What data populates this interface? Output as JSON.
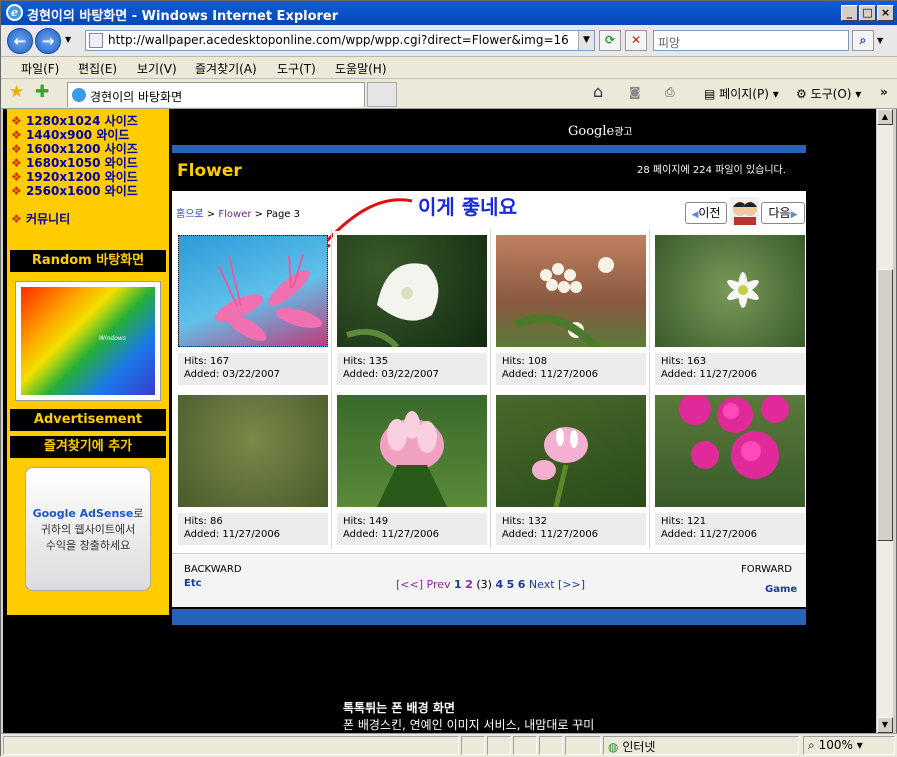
{
  "window": {
    "title": "경현이의 바탕화면 - Windows Internet Explorer"
  },
  "address": {
    "url": "http://wallpaper.acedesktoponline.com/wpp/wpp.cgi?direct=Flower&img=16",
    "search_placeholder": "피앙"
  },
  "menu": [
    "파일(F)",
    "편집(E)",
    "보기(V)",
    "즐겨찾기(A)",
    "도구(T)",
    "도움말(H)"
  ],
  "tab": {
    "label": "경현이의 바탕화면"
  },
  "toolbar": {
    "page_label": "페이지(P)",
    "tools_label": "도구(O)"
  },
  "sidebar": {
    "links": [
      "1280x1024 사이즈",
      "1440x900 와이드",
      "1600x1200 사이즈",
      "1680x1050 와이드",
      "1920x1200 와이드",
      "2560x1600 와이드"
    ],
    "community": "커뮤니티",
    "random_header": "Random 바탕화면",
    "random_img_text": "Windows",
    "ad_header": "Advertisement",
    "fav_header": "즐겨찾기에 추가",
    "adsense_brand": "Google AdSense",
    "adsense_line1": "로",
    "adsense_line2": "귀하의 웹사이트에서",
    "adsense_line3": "수익을 창출하세요"
  },
  "google_ad": {
    "brand": "Google",
    "suffix": "광고"
  },
  "gallery": {
    "title": "Flower",
    "page_count": "28 페이지에 224 파일이 있습니다.",
    "crumb_home": "홈으로",
    "crumb_sep1": ">",
    "crumb_cat": "Flower",
    "crumb_sep2": ">",
    "crumb_page": "Page 3",
    "annotation": "이게 좋네요",
    "prev": "이전",
    "next": "다음",
    "items": [
      {
        "hits": "Hits: 167",
        "added": "Added: 03/22/2007"
      },
      {
        "hits": "Hits: 135",
        "added": "Added: 03/22/2007"
      },
      {
        "hits": "Hits: 108",
        "added": "Added: 11/27/2006"
      },
      {
        "hits": "Hits: 163",
        "added": "Added: 11/27/2006"
      },
      {
        "hits": "Hits: 86",
        "added": "Added: 11/27/2006"
      },
      {
        "hits": "Hits: 149",
        "added": "Added: 11/27/2006"
      },
      {
        "hits": "Hits: 132",
        "added": "Added: 11/27/2006"
      },
      {
        "hits": "Hits: 121",
        "added": "Added: 11/27/2006"
      }
    ],
    "backward": "BACKWARD",
    "backward_link": "Etc",
    "forward": "FORWARD",
    "forward_link": "Game",
    "pager": {
      "first": "[<<]",
      "prev": "Prev",
      "p1": "1",
      "p2": "2",
      "current": "(3)",
      "p4": "4",
      "p5": "5",
      "p6": "6",
      "next": "Next",
      "last": "[>>]"
    }
  },
  "bottom": {
    "title": "톡톡튀는 폰 배경 화면",
    "desc": "폰 배경스킨, 연예인 이미지 서비스, 내맘대로 꾸미"
  },
  "status": {
    "zone": "인터넷",
    "zoom": "100%"
  }
}
